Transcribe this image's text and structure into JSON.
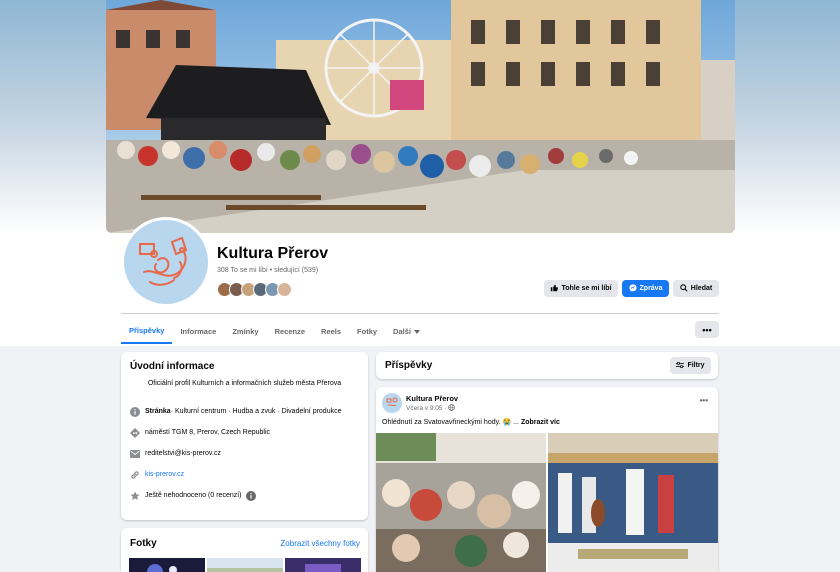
{
  "page": {
    "name": "Kultura Přerov",
    "stats": "308 To se mi líbí • sledující (539)"
  },
  "colors": {
    "accent": "#1877f2",
    "background": "#f0f2f5"
  },
  "actions": {
    "like": "Tohle se mi líbí",
    "message": "Zpráva",
    "search": "Hledat",
    "more": "•••"
  },
  "tabs": [
    "Příspěvky",
    "Informace",
    "Zmínky",
    "Recenze",
    "Reels",
    "Fotky",
    "Další"
  ],
  "intro": {
    "title": "Úvodní informace",
    "description": "Oficiální profil Kulturních a informačních služeb města Přerova",
    "category_prefix": "Stránka",
    "category": " · Kulturní centrum · Hudba a zvuk · Divadelní produkce",
    "address": "náměstí TGM 8, Prerov, Czech Republic",
    "email": "reditelstvi@kis-prerov.cz",
    "website": "kis-prerov.cz",
    "rating": "Ještě nehodnoceno (0 recenzí)"
  },
  "photos": {
    "title": "Fotky",
    "see_all": "Zobrazit všechny fotky"
  },
  "posts": {
    "title": "Příspěvky",
    "filters": "Filtry"
  },
  "post": {
    "author": "Kultura Přerov",
    "time": "Včera v 9:05 · ",
    "text": "Ohlédnutí za Svatovavřineckými hody. 😭 ... ",
    "see_more": "Zobrazit víc",
    "menu": "•••"
  },
  "icons": {
    "like": "thumbs-up-icon",
    "message": "messenger-icon",
    "search": "search-icon",
    "info": "info-icon",
    "location": "location-icon",
    "email": "email-icon",
    "link": "link-icon",
    "star": "star-icon",
    "globe": "globe-icon",
    "filter": "filter-icon"
  }
}
